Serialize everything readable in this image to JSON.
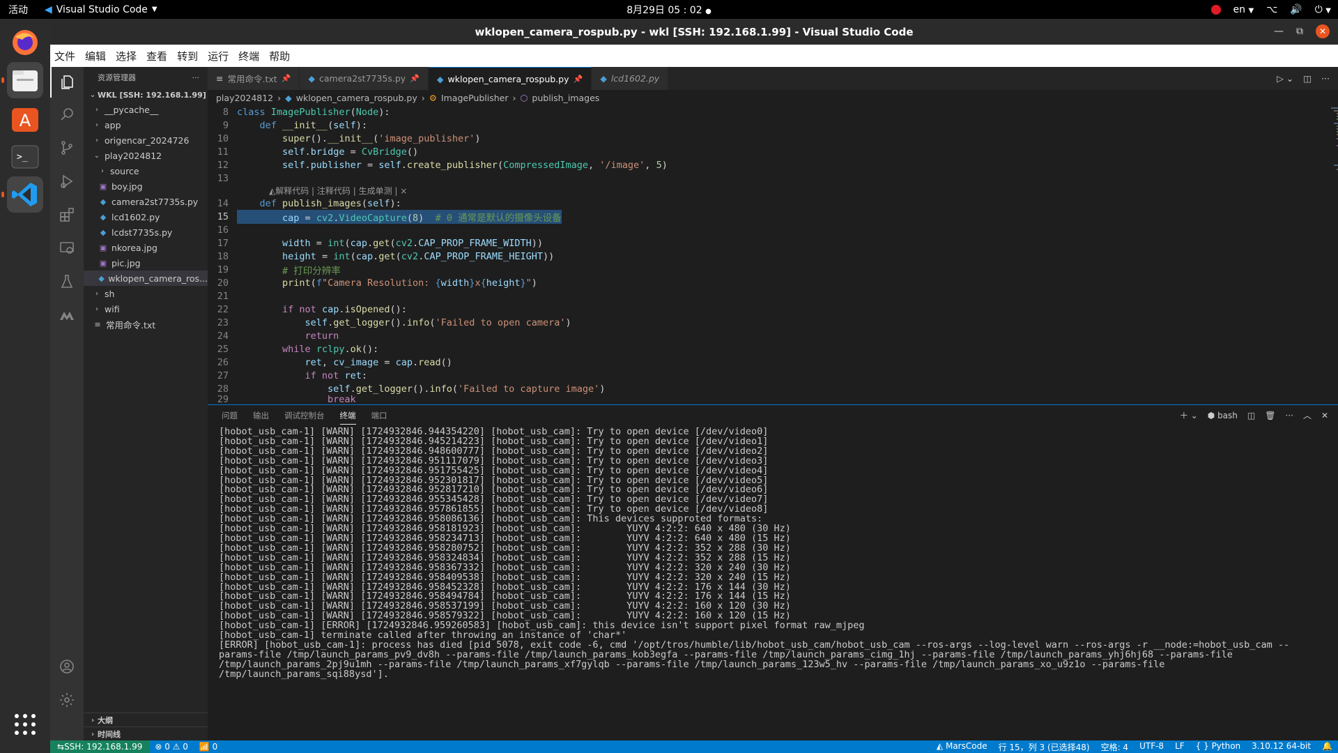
{
  "topbar": {
    "activities": "活动",
    "app_name": "Visual Studio Code",
    "clock": "8月29日  05 : 02",
    "lang": "en"
  },
  "window": {
    "title": "wklopen_camera_rospub.py - wkl [SSH: 192.168.1.99] - Visual Studio Code"
  },
  "menu": [
    "文件",
    "编辑",
    "选择",
    "查看",
    "转到",
    "运行",
    "终端",
    "帮助"
  ],
  "sidebar": {
    "title": "资源管理器",
    "root": "WKL [SSH: 192.168.1.99]",
    "items": [
      {
        "label": "__pycache__",
        "type": "folder",
        "depth": 1
      },
      {
        "label": "app",
        "type": "folder",
        "depth": 1
      },
      {
        "label": "origencar_2024726",
        "type": "folder",
        "depth": 1
      },
      {
        "label": "play2024812",
        "type": "folder-open",
        "depth": 1
      },
      {
        "label": "source",
        "type": "folder",
        "depth": 2
      },
      {
        "label": "boy.jpg",
        "type": "img",
        "depth": 2
      },
      {
        "label": "camera2st7735s.py",
        "type": "py",
        "depth": 2
      },
      {
        "label": "lcd1602.py",
        "type": "py",
        "depth": 2
      },
      {
        "label": "lcdst7735s.py",
        "type": "py",
        "depth": 2
      },
      {
        "label": "nkorea.jpg",
        "type": "img",
        "depth": 2
      },
      {
        "label": "pic.jpg",
        "type": "img",
        "depth": 2
      },
      {
        "label": "wklopen_camera_ros...",
        "type": "py",
        "depth": 2,
        "selected": true
      },
      {
        "label": "sh",
        "type": "folder",
        "depth": 1
      },
      {
        "label": "wifi",
        "type": "folder",
        "depth": 1
      },
      {
        "label": "常用命令.txt",
        "type": "txt",
        "depth": 1
      }
    ],
    "outline": "大纲",
    "timeline": "时间线"
  },
  "tabs": [
    {
      "label": "常用命令.txt",
      "type": "txt"
    },
    {
      "label": "camera2st7735s.py",
      "type": "py"
    },
    {
      "label": "wklopen_camera_rospub.py",
      "type": "py",
      "active": true
    },
    {
      "label": "lcd1602.py",
      "type": "py"
    }
  ],
  "breadcrumb": [
    "play2024812",
    "wklopen_camera_rospub.py",
    "ImagePublisher",
    "publish_images"
  ],
  "codelens": "解释代码 | 注释代码 | 生成单测 | ×",
  "code_lines": {
    "l8": "8",
    "l9": "9",
    "l10": "10",
    "l11": "11",
    "l12": "12",
    "l13": "13",
    "l14": "14",
    "l15": "15",
    "l16": "16",
    "l17": "17",
    "l18": "18",
    "l19": "19",
    "l20": "20",
    "l21": "21",
    "l22": "22",
    "l23": "23",
    "l24": "24",
    "l25": "25",
    "l26": "26",
    "l27": "27",
    "l28": "28",
    "l29": "29"
  },
  "panel": {
    "tabs": [
      "问题",
      "输出",
      "调试控制台",
      "终端",
      "端口"
    ],
    "active_tab": "终端",
    "shell": "bash",
    "terminal_lines": [
      "[hobot_usb_cam-1] [WARN] [1724932846.944354220] [hobot_usb_cam]: Try to open device [/dev/video0]",
      "[hobot_usb_cam-1] [WARN] [1724932846.945214223] [hobot_usb_cam]: Try to open device [/dev/video1]",
      "[hobot_usb_cam-1] [WARN] [1724932846.948600777] [hobot_usb_cam]: Try to open device [/dev/video2]",
      "[hobot_usb_cam-1] [WARN] [1724932846.951117079] [hobot_usb_cam]: Try to open device [/dev/video3]",
      "[hobot_usb_cam-1] [WARN] [1724932846.951755425] [hobot_usb_cam]: Try to open device [/dev/video4]",
      "[hobot_usb_cam-1] [WARN] [1724932846.952301817] [hobot_usb_cam]: Try to open device [/dev/video5]",
      "[hobot_usb_cam-1] [WARN] [1724932846.952817210] [hobot_usb_cam]: Try to open device [/dev/video6]",
      "[hobot_usb_cam-1] [WARN] [1724932846.955345428] [hobot_usb_cam]: Try to open device [/dev/video7]",
      "[hobot_usb_cam-1] [WARN] [1724932846.957861855] [hobot_usb_cam]: Try to open device [/dev/video8]",
      "[hobot_usb_cam-1] [WARN] [1724932846.958086136] [hobot_usb_cam]: This devices supproted formats:",
      "[hobot_usb_cam-1] [WARN] [1724932846.958181923] [hobot_usb_cam]:        YUYV 4:2:2: 640 x 480 (30 Hz)",
      "[hobot_usb_cam-1] [WARN] [1724932846.958234713] [hobot_usb_cam]:        YUYV 4:2:2: 640 x 480 (15 Hz)",
      "[hobot_usb_cam-1] [WARN] [1724932846.958280752] [hobot_usb_cam]:        YUYV 4:2:2: 352 x 288 (30 Hz)",
      "[hobot_usb_cam-1] [WARN] [1724932846.958324834] [hobot_usb_cam]:        YUYV 4:2:2: 352 x 288 (15 Hz)",
      "[hobot_usb_cam-1] [WARN] [1724932846.958367332] [hobot_usb_cam]:        YUYV 4:2:2: 320 x 240 (30 Hz)",
      "[hobot_usb_cam-1] [WARN] [1724932846.958409538] [hobot_usb_cam]:        YUYV 4:2:2: 320 x 240 (15 Hz)",
      "[hobot_usb_cam-1] [WARN] [1724932846.958452328] [hobot_usb_cam]:        YUYV 4:2:2: 176 x 144 (30 Hz)",
      "[hobot_usb_cam-1] [WARN] [1724932846.958494784] [hobot_usb_cam]:        YUYV 4:2:2: 176 x 144 (15 Hz)",
      "[hobot_usb_cam-1] [WARN] [1724932846.958537199] [hobot_usb_cam]:        YUYV 4:2:2: 160 x 120 (30 Hz)",
      "[hobot_usb_cam-1] [WARN] [1724932846.958579322] [hobot_usb_cam]:        YUYV 4:2:2: 160 x 120 (15 Hz)",
      "[hobot_usb_cam-1] [ERROR] [1724932846.959260583] [hobot_usb_cam]: this device isn't support pixel format raw_mjpeg",
      "[hobot_usb_cam-1] terminate called after throwing an instance of 'char*'"
    ],
    "terminal_error": "[ERROR] [hobot_usb_cam-1]: process has died [pid 5078, exit code -6, cmd '/opt/tros/humble/lib/hobot_usb_cam/hobot_usb_cam --ros-args --log-level warn --ros-args -r __node:=hobot_usb_cam --params-file /tmp/launch_params_pv9_dv8h --params-file /tmp/launch_params_kob3egfa --params-file /tmp/launch_params_cimg_1hj --params-file /tmp/launch_params_yhj6hj68 --params-file /tmp/launch_params_2pj9u1mh --params-file /tmp/launch_params_xf7gylqb --params-file /tmp/launch_params_123w5_hv --params-file /tmp/launch_params_xo_u9z1o --params-file /tmp/launch_params_sqi88ysd']."
  },
  "status": {
    "remote": "SSH: 192.168.1.99",
    "errors": "0",
    "warnings": "0",
    "ports": "0",
    "marscode": "MarsCode",
    "position": "行 15，列 3 (已选择48)",
    "spaces": "空格: 4",
    "encoding": "UTF-8",
    "eol": "LF",
    "language": "Python",
    "interpreter": "3.10.12 64-bit"
  }
}
